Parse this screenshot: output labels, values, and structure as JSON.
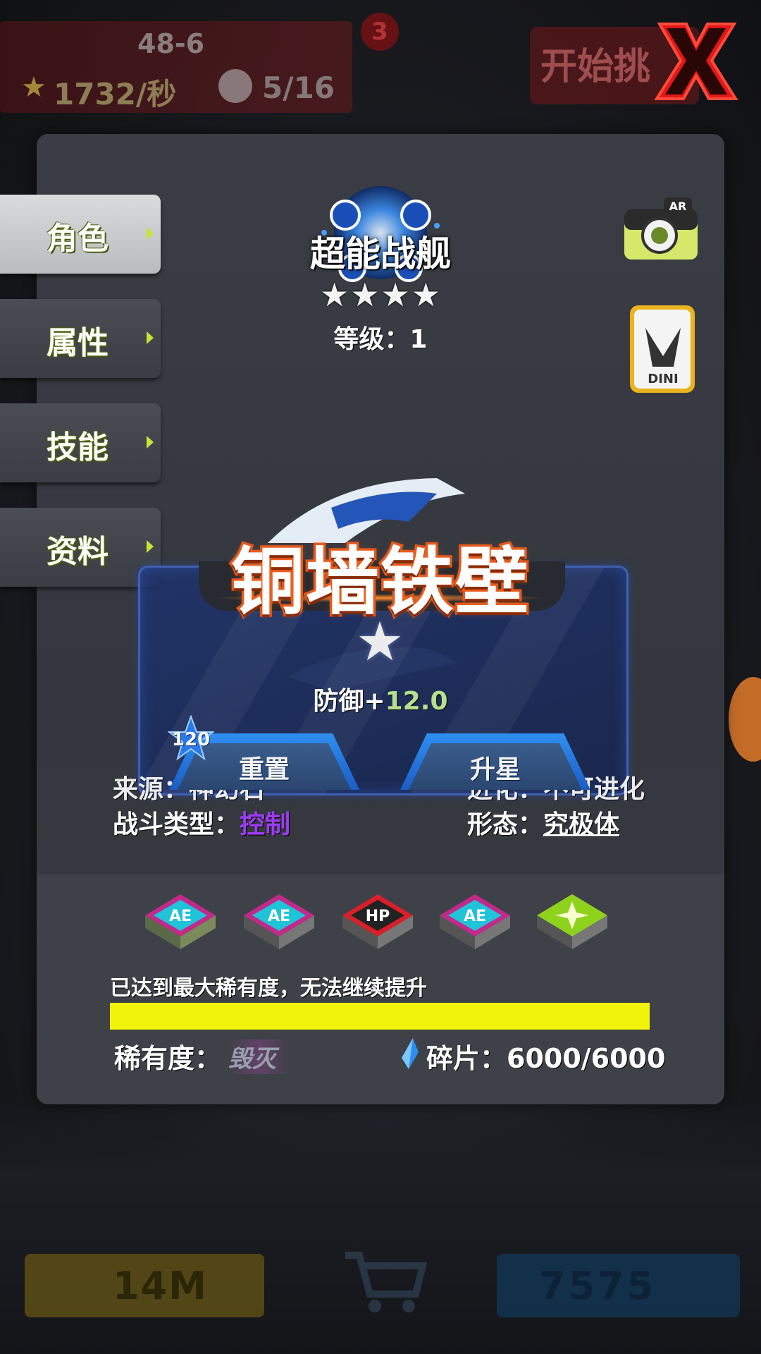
{
  "hud": {
    "stage": "48-6",
    "rate": "1732/秒",
    "mice": "5/16",
    "badge": "3",
    "start_label": "开始挑",
    "bottom_left_value": "14M",
    "bottom_right_value": "7575"
  },
  "tabs": [
    {
      "label": "角色",
      "active": true
    },
    {
      "label": "属性",
      "active": false
    },
    {
      "label": "技能",
      "active": false
    },
    {
      "label": "资料",
      "active": false
    }
  ],
  "character": {
    "name": "超能战舰",
    "star_count": 4,
    "level_text": "等级：1"
  },
  "skill": {
    "name": "铜墙铁壁",
    "effect_label": "防御+",
    "effect_value": "12.0",
    "badge_level": "120",
    "reset_label": "重置",
    "upgrade_label": "升星"
  },
  "info": {
    "source_label": "来源：",
    "source_value": "神幻石",
    "evolve_label": "进化：",
    "evolve_value": "不可进化",
    "battle_type_label": "战斗类型：",
    "battle_type_value": "控制",
    "form_label": "形态：",
    "form_value": "究极体"
  },
  "rarity": {
    "icons": [
      "ae-icon",
      "ae-icon",
      "hp-icon",
      "ae-icon",
      "spark-icon"
    ],
    "message": "已达到最大稀有度，无法继续提升",
    "progress": 1.0,
    "label": "稀有度：",
    "value": "毁灭",
    "shards_text": "碎片：6000/6000"
  },
  "colors": {
    "accent_green": "#c6e436",
    "progress": "#f2f30a",
    "battle_type": "#9c3cf2",
    "skill_stroke": "#e2561c",
    "effect_value": "#b6e08e",
    "close_red": "#e01818"
  }
}
